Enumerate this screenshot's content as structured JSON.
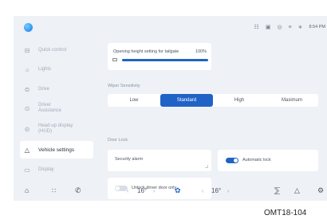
{
  "sidebar": {
    "items": [
      {
        "icon": "tailgate-icon",
        "glyph": "⊟",
        "label": "Quick control"
      },
      {
        "icon": "lights-icon",
        "glyph": "☼",
        "label": "Lights"
      },
      {
        "icon": "drive-icon",
        "glyph": "⊜",
        "label": "Drive"
      },
      {
        "icon": "driver-assistance-icon",
        "glyph": "⊙",
        "label": "Driver\nAssistance"
      },
      {
        "icon": "head-up-display-icon",
        "glyph": "⊝",
        "label": "Head-up display\n(HUD)"
      },
      {
        "icon": "car-icon",
        "glyph": "△",
        "label": "Vehicle settings"
      },
      {
        "icon": "display-icon",
        "glyph": "▭",
        "label": "Display"
      }
    ]
  },
  "tailgate": {
    "title": "Opening height setting for tailgate",
    "value_label": "100%",
    "fill_fraction": 1.0
  },
  "wiper": {
    "label": "Wiper Sensitivity",
    "options": [
      "Low",
      "Standard",
      "High",
      "Maximum"
    ],
    "selected": "Standard"
  },
  "door_lock": {
    "label": "Door Lock",
    "security_alarm": "Security alarm",
    "automatic_lock": {
      "label": "Automatic lock",
      "on": true
    },
    "unlock_driver_door_only": {
      "label": "Unlock driver door only",
      "on": false
    }
  },
  "climate": {
    "left_temp": "16°",
    "right_temp": "16°"
  },
  "caption": "OMT18-104"
}
